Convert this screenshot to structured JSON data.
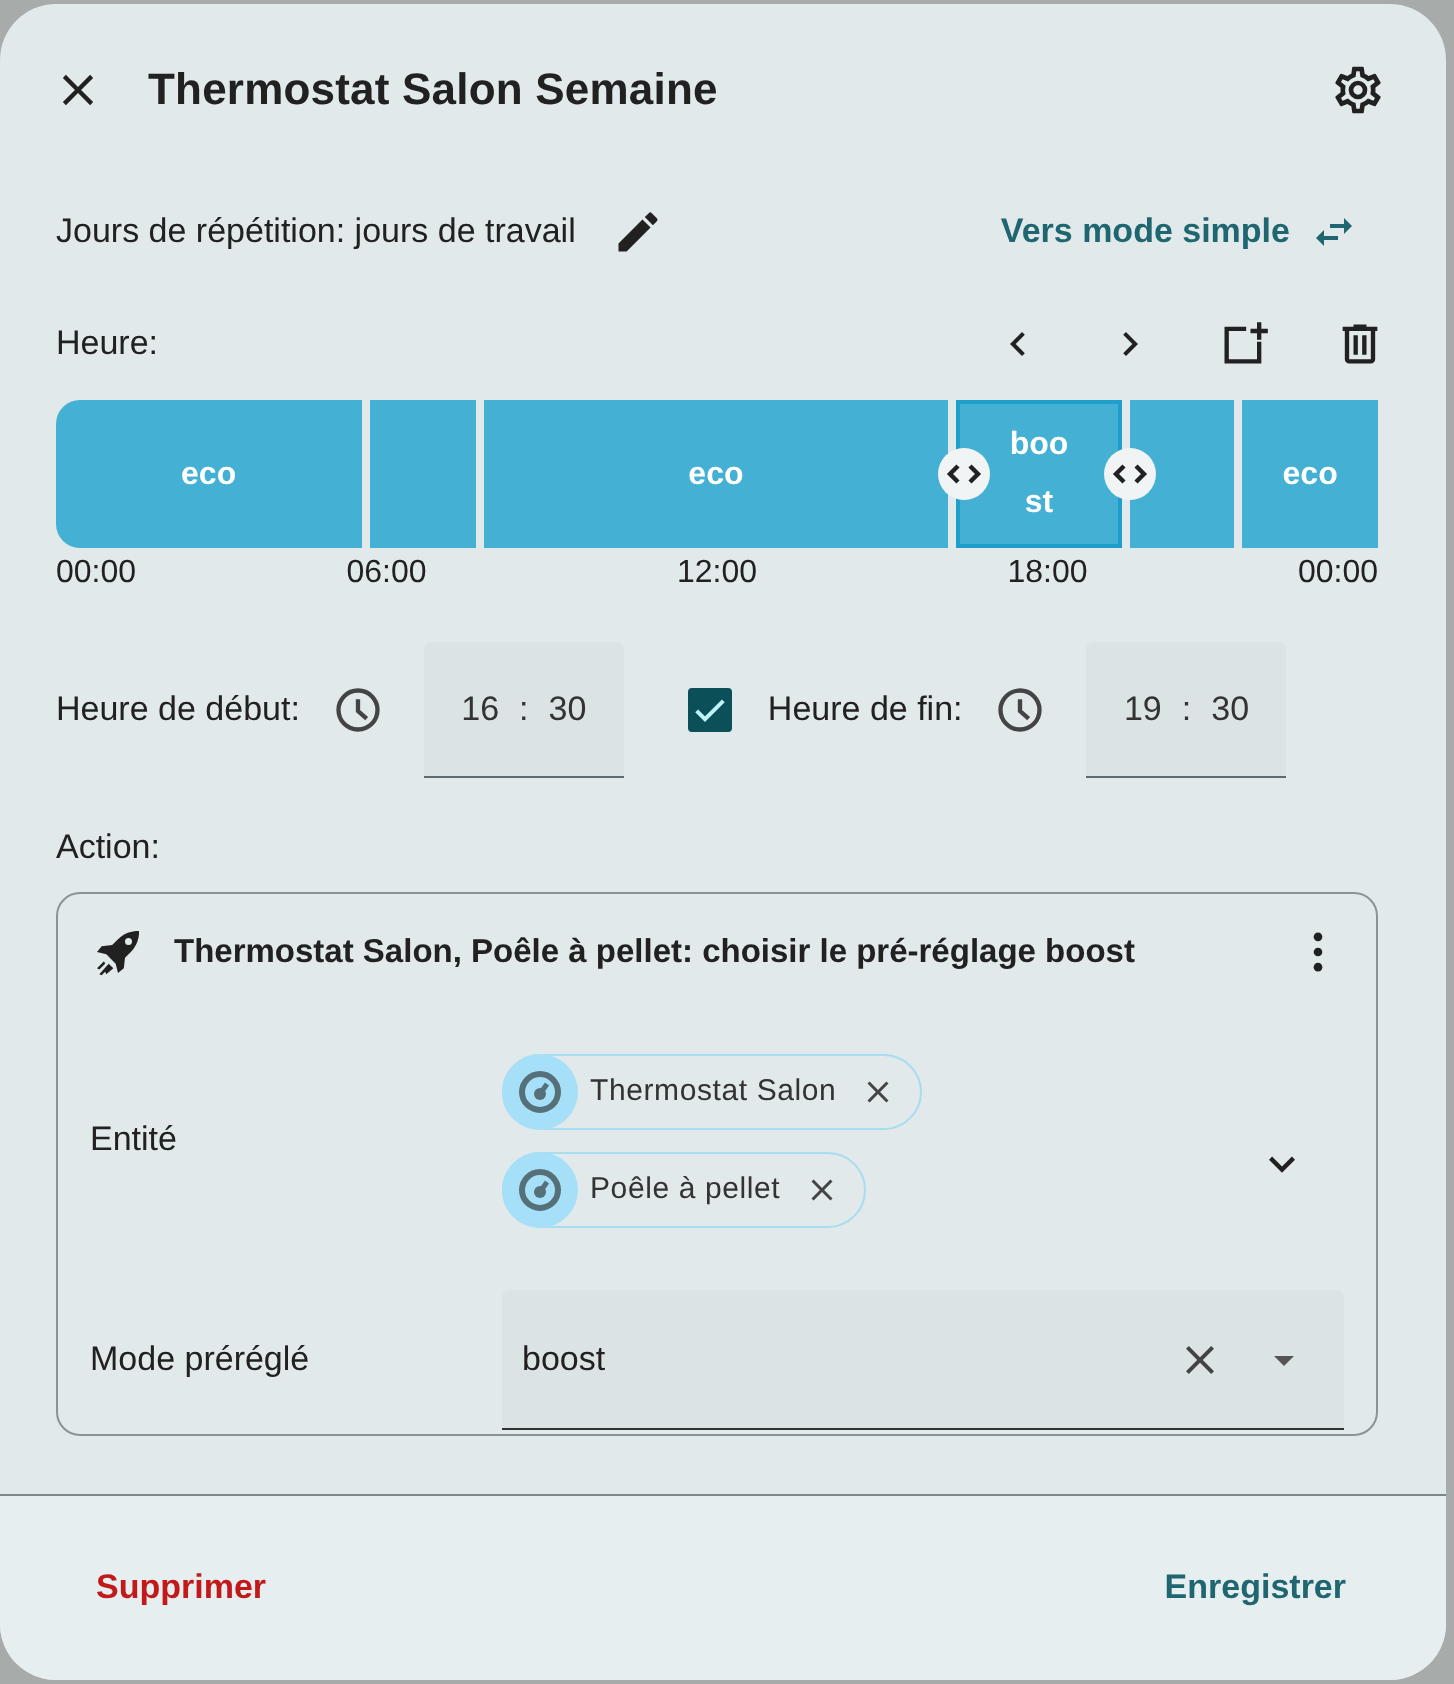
{
  "dialog": {
    "title": "Thermostat Salon Semaine"
  },
  "repeat": {
    "label": "Jours de répétition: jours de travail"
  },
  "mode_link": {
    "label": "Vers mode simple"
  },
  "time_label": "Heure:",
  "timeline": {
    "segments": [
      {
        "label": "eco",
        "selected": false
      },
      {
        "selected": false
      },
      {
        "label": "eco",
        "selected": false
      },
      {
        "label": "boost",
        "selected": true
      },
      {
        "selected": false
      },
      {
        "label": "eco",
        "selected": false
      }
    ],
    "ticks": [
      "00:00",
      "06:00",
      "12:00",
      "18:00",
      "00:00"
    ]
  },
  "start": {
    "label": "Heure de début:",
    "hours": "16",
    "separator": ":",
    "minutes": "30"
  },
  "end_enabled": {
    "checked": true
  },
  "end": {
    "label": "Heure de fin:",
    "hours": "19",
    "separator": ":",
    "minutes": "30"
  },
  "action": {
    "label": "Action:",
    "title": "Thermostat Salon, Poêle à pellet: choisir le pré-réglage boost",
    "entity_label": "Entité",
    "entities": [
      "Thermostat Salon",
      "Poêle à pellet"
    ],
    "preset_label": "Mode préréglé",
    "preset_value": "boost"
  },
  "buttons": {
    "delete": "Supprimer",
    "save": "Enregistrer"
  }
}
